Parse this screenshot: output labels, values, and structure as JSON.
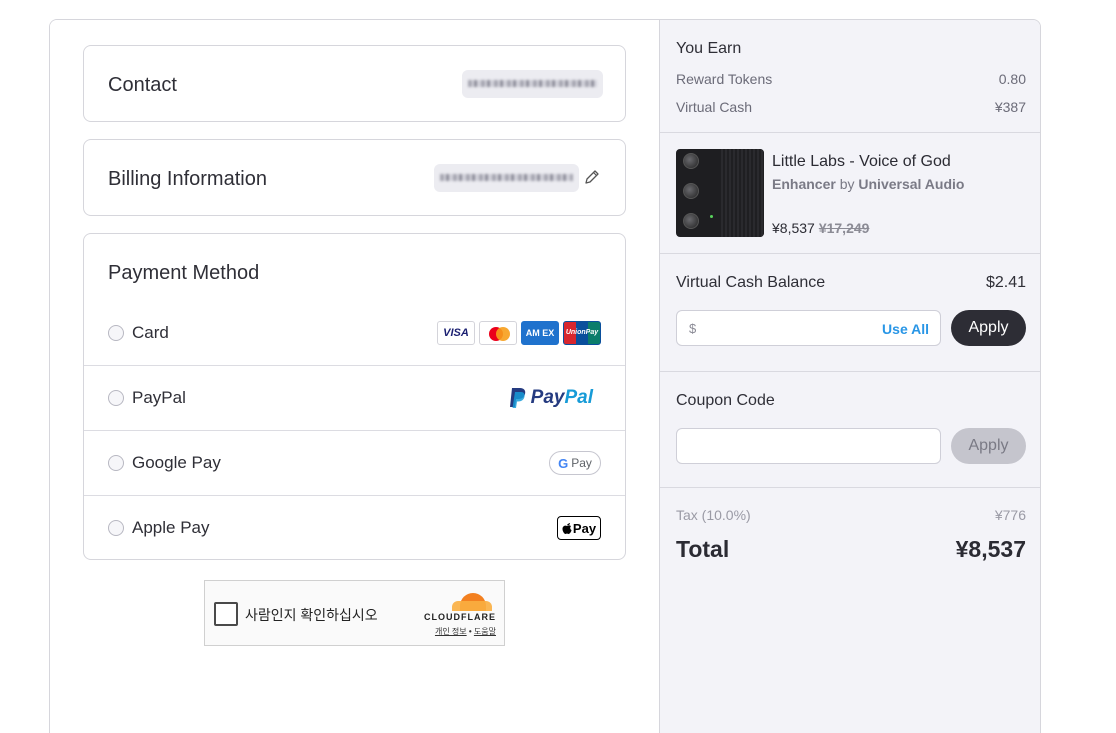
{
  "contact": {
    "title": "Contact"
  },
  "billing": {
    "title": "Billing Information"
  },
  "payment": {
    "title": "Payment Method",
    "options": [
      {
        "label": "Card"
      },
      {
        "label": "PayPal"
      },
      {
        "label": "Google Pay"
      },
      {
        "label": "Apple Pay"
      }
    ],
    "card_brands": [
      "VISA",
      "MC",
      "AM EX",
      "UnionPay"
    ],
    "paypal_text": [
      "Pay",
      "Pal"
    ],
    "gpay_text": "Pay",
    "apay_text": "Pay"
  },
  "captcha": {
    "text": "사람인지 확인하십시오",
    "brand": "CLOUDFLARE",
    "link_privacy": "개인 정보",
    "link_separator": "•",
    "link_help": "도움말"
  },
  "earn": {
    "title": "You Earn",
    "rows": [
      {
        "label": "Reward Tokens",
        "value": "0.80"
      },
      {
        "label": "Virtual Cash",
        "value": "¥387"
      }
    ]
  },
  "product": {
    "name": "Little Labs - Voice of God",
    "category": "Enhancer",
    "by": "by",
    "vendor": "Universal Audio",
    "price": "¥8,537",
    "old_price": "¥17,249"
  },
  "vcash": {
    "title": "Virtual Cash Balance",
    "balance": "$2.41",
    "prefix": "$",
    "use_all": "Use All",
    "apply": "Apply"
  },
  "coupon": {
    "title": "Coupon Code",
    "apply": "Apply"
  },
  "totals": {
    "tax_label": "Tax (10.0%)",
    "tax_value": "¥776",
    "total_label": "Total",
    "total_value": "¥8,537"
  },
  "colors": {
    "accent_link": "#2996e6",
    "panel_bg": "#f3f3f8",
    "dark_button": "#2d2d35"
  }
}
